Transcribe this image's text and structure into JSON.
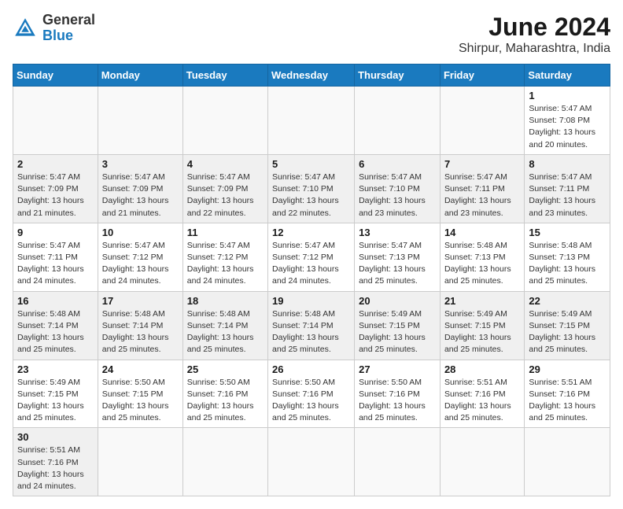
{
  "header": {
    "logo_general": "General",
    "logo_blue": "Blue",
    "month": "June 2024",
    "location": "Shirpur, Maharashtra, India"
  },
  "days_of_week": [
    "Sunday",
    "Monday",
    "Tuesday",
    "Wednesday",
    "Thursday",
    "Friday",
    "Saturday"
  ],
  "weeks": [
    {
      "days": [
        {
          "num": "",
          "info": ""
        },
        {
          "num": "",
          "info": ""
        },
        {
          "num": "",
          "info": ""
        },
        {
          "num": "",
          "info": ""
        },
        {
          "num": "",
          "info": ""
        },
        {
          "num": "",
          "info": ""
        },
        {
          "num": "1",
          "info": "Sunrise: 5:47 AM\nSunset: 7:08 PM\nDaylight: 13 hours\nand 20 minutes."
        }
      ]
    },
    {
      "days": [
        {
          "num": "2",
          "info": "Sunrise: 5:47 AM\nSunset: 7:09 PM\nDaylight: 13 hours\nand 21 minutes."
        },
        {
          "num": "3",
          "info": "Sunrise: 5:47 AM\nSunset: 7:09 PM\nDaylight: 13 hours\nand 21 minutes."
        },
        {
          "num": "4",
          "info": "Sunrise: 5:47 AM\nSunset: 7:09 PM\nDaylight: 13 hours\nand 22 minutes."
        },
        {
          "num": "5",
          "info": "Sunrise: 5:47 AM\nSunset: 7:10 PM\nDaylight: 13 hours\nand 22 minutes."
        },
        {
          "num": "6",
          "info": "Sunrise: 5:47 AM\nSunset: 7:10 PM\nDaylight: 13 hours\nand 23 minutes."
        },
        {
          "num": "7",
          "info": "Sunrise: 5:47 AM\nSunset: 7:11 PM\nDaylight: 13 hours\nand 23 minutes."
        },
        {
          "num": "8",
          "info": "Sunrise: 5:47 AM\nSunset: 7:11 PM\nDaylight: 13 hours\nand 23 minutes."
        }
      ]
    },
    {
      "days": [
        {
          "num": "9",
          "info": "Sunrise: 5:47 AM\nSunset: 7:11 PM\nDaylight: 13 hours\nand 24 minutes."
        },
        {
          "num": "10",
          "info": "Sunrise: 5:47 AM\nSunset: 7:12 PM\nDaylight: 13 hours\nand 24 minutes."
        },
        {
          "num": "11",
          "info": "Sunrise: 5:47 AM\nSunset: 7:12 PM\nDaylight: 13 hours\nand 24 minutes."
        },
        {
          "num": "12",
          "info": "Sunrise: 5:47 AM\nSunset: 7:12 PM\nDaylight: 13 hours\nand 24 minutes."
        },
        {
          "num": "13",
          "info": "Sunrise: 5:47 AM\nSunset: 7:13 PM\nDaylight: 13 hours\nand 25 minutes."
        },
        {
          "num": "14",
          "info": "Sunrise: 5:48 AM\nSunset: 7:13 PM\nDaylight: 13 hours\nand 25 minutes."
        },
        {
          "num": "15",
          "info": "Sunrise: 5:48 AM\nSunset: 7:13 PM\nDaylight: 13 hours\nand 25 minutes."
        }
      ]
    },
    {
      "days": [
        {
          "num": "16",
          "info": "Sunrise: 5:48 AM\nSunset: 7:14 PM\nDaylight: 13 hours\nand 25 minutes."
        },
        {
          "num": "17",
          "info": "Sunrise: 5:48 AM\nSunset: 7:14 PM\nDaylight: 13 hours\nand 25 minutes."
        },
        {
          "num": "18",
          "info": "Sunrise: 5:48 AM\nSunset: 7:14 PM\nDaylight: 13 hours\nand 25 minutes."
        },
        {
          "num": "19",
          "info": "Sunrise: 5:48 AM\nSunset: 7:14 PM\nDaylight: 13 hours\nand 25 minutes."
        },
        {
          "num": "20",
          "info": "Sunrise: 5:49 AM\nSunset: 7:15 PM\nDaylight: 13 hours\nand 25 minutes."
        },
        {
          "num": "21",
          "info": "Sunrise: 5:49 AM\nSunset: 7:15 PM\nDaylight: 13 hours\nand 25 minutes."
        },
        {
          "num": "22",
          "info": "Sunrise: 5:49 AM\nSunset: 7:15 PM\nDaylight: 13 hours\nand 25 minutes."
        }
      ]
    },
    {
      "days": [
        {
          "num": "23",
          "info": "Sunrise: 5:49 AM\nSunset: 7:15 PM\nDaylight: 13 hours\nand 25 minutes."
        },
        {
          "num": "24",
          "info": "Sunrise: 5:50 AM\nSunset: 7:15 PM\nDaylight: 13 hours\nand 25 minutes."
        },
        {
          "num": "25",
          "info": "Sunrise: 5:50 AM\nSunset: 7:16 PM\nDaylight: 13 hours\nand 25 minutes."
        },
        {
          "num": "26",
          "info": "Sunrise: 5:50 AM\nSunset: 7:16 PM\nDaylight: 13 hours\nand 25 minutes."
        },
        {
          "num": "27",
          "info": "Sunrise: 5:50 AM\nSunset: 7:16 PM\nDaylight: 13 hours\nand 25 minutes."
        },
        {
          "num": "28",
          "info": "Sunrise: 5:51 AM\nSunset: 7:16 PM\nDaylight: 13 hours\nand 25 minutes."
        },
        {
          "num": "29",
          "info": "Sunrise: 5:51 AM\nSunset: 7:16 PM\nDaylight: 13 hours\nand 25 minutes."
        }
      ]
    },
    {
      "days": [
        {
          "num": "30",
          "info": "Sunrise: 5:51 AM\nSunset: 7:16 PM\nDaylight: 13 hours\nand 24 minutes."
        },
        {
          "num": "",
          "info": ""
        },
        {
          "num": "",
          "info": ""
        },
        {
          "num": "",
          "info": ""
        },
        {
          "num": "",
          "info": ""
        },
        {
          "num": "",
          "info": ""
        },
        {
          "num": "",
          "info": ""
        }
      ]
    }
  ]
}
